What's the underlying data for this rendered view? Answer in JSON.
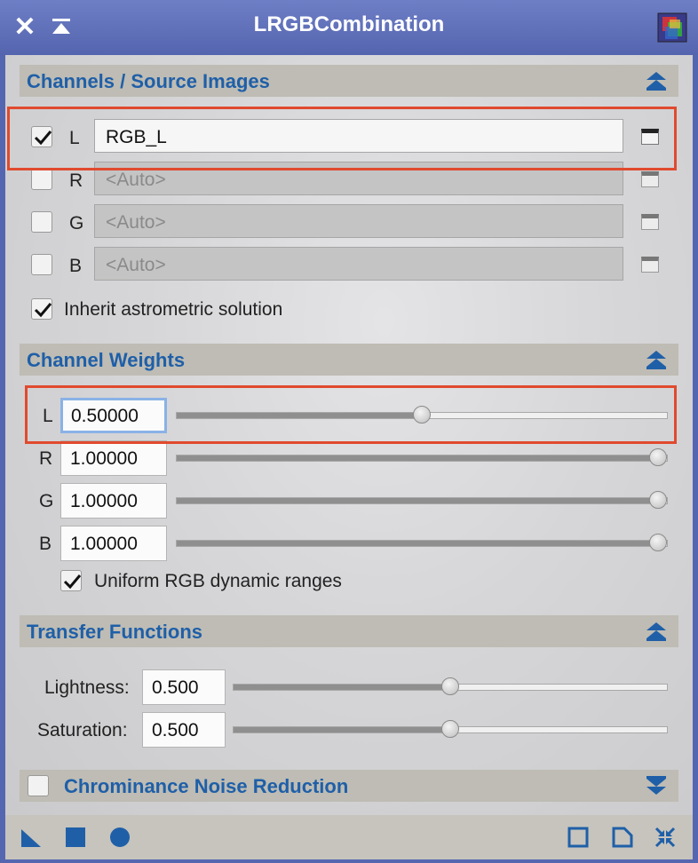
{
  "window": {
    "title": "LRGBCombination"
  },
  "channels_section": {
    "title": "Channels / Source Images",
    "rows": [
      {
        "label": "L",
        "checked": true,
        "value": "RGB_L",
        "placeholder": ""
      },
      {
        "label": "R",
        "checked": false,
        "value": "",
        "placeholder": "<Auto>"
      },
      {
        "label": "G",
        "checked": false,
        "value": "",
        "placeholder": "<Auto>"
      },
      {
        "label": "B",
        "checked": false,
        "value": "",
        "placeholder": "<Auto>"
      }
    ],
    "inherit_astrometric": {
      "label": "Inherit astrometric solution",
      "checked": true
    }
  },
  "weights_section": {
    "title": "Channel Weights",
    "rows": [
      {
        "label": "L",
        "value": "0.50000",
        "fraction": 0.5
      },
      {
        "label": "R",
        "value": "1.00000",
        "fraction": 1.0
      },
      {
        "label": "G",
        "value": "1.00000",
        "fraction": 1.0
      },
      {
        "label": "B",
        "value": "1.00000",
        "fraction": 1.0
      }
    ],
    "uniform_rgb": {
      "label": "Uniform RGB dynamic ranges",
      "checked": true
    }
  },
  "transfer_section": {
    "title": "Transfer Functions",
    "lightness": {
      "label": "Lightness:",
      "value": "0.500",
      "fraction": 0.5
    },
    "saturation": {
      "label": "Saturation:",
      "value": "0.500",
      "fraction": 0.5
    }
  },
  "noise_section": {
    "title": "Chrominance Noise Reduction",
    "checked": false
  },
  "colors": {
    "accent": "#1f5fa8",
    "highlight": "#e04a2e",
    "titlebar": "#5e6eb8"
  },
  "icons": {
    "titlebar": [
      "close-icon",
      "shade-icon",
      "process-icon"
    ],
    "bottom_left": [
      "new-instance-icon",
      "apply-global-icon",
      "apply-icon"
    ],
    "bottom_right": [
      "browse-documentation-icon",
      "edit-instance-icon",
      "reset-icon"
    ]
  }
}
